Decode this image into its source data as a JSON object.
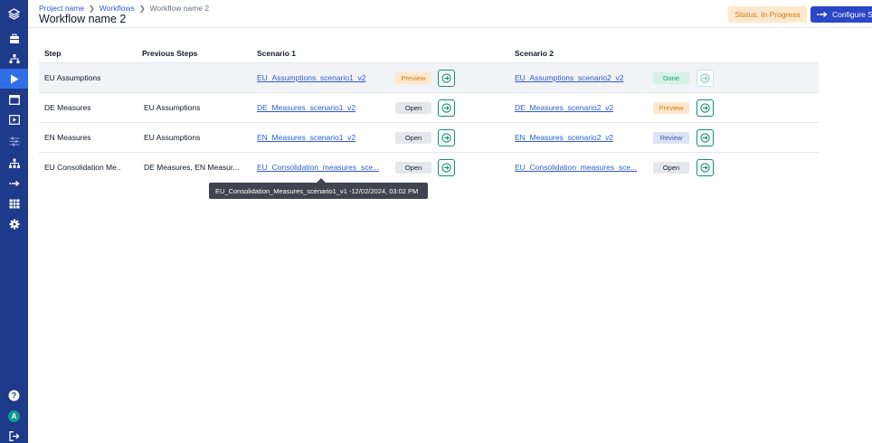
{
  "sidebar": {
    "items": [
      {
        "icon": "layers-icon"
      },
      {
        "icon": "briefcase-icon"
      },
      {
        "icon": "hierarchy-icon"
      },
      {
        "icon": "play-icon",
        "active": true
      },
      {
        "icon": "window-icon"
      },
      {
        "icon": "video-icon"
      },
      {
        "icon": "sliders-icon"
      },
      {
        "icon": "sitemap-icon"
      },
      {
        "icon": "arrow-right-icon"
      },
      {
        "icon": "grid-icon"
      },
      {
        "icon": "gear-icon"
      }
    ],
    "bottom": {
      "help_icon": "help-icon",
      "avatar_letter": "A",
      "logout_icon": "logout-icon"
    }
  },
  "header": {
    "breadcrumb": [
      "Project name",
      "Workflows",
      "Workflow name 2"
    ],
    "title": "Workflow name 2",
    "status": "Status: In Progress",
    "configure_label": "Configure Steps"
  },
  "table": {
    "headers": {
      "step": "Step",
      "previous": "Previous Steps",
      "scenario1": "Scenario 1",
      "scenario2": "Scenario 2"
    },
    "rows": [
      {
        "step": "EU Assumptions",
        "previous": "",
        "s1_link": "EU_Assumptions_scenario1_v2",
        "s1_badge": "Preview",
        "s2_link": "EU_Assumptions_scenario2_v2",
        "s2_badge": "Done"
      },
      {
        "step": "DE Measures",
        "previous": "EU Assumptions",
        "s1_link": "DE_Measures_scenario1_v2",
        "s1_badge": "Open",
        "s2_link": "DE_Measures_scenario2_v2",
        "s2_badge": "Preview"
      },
      {
        "step": "EN Measures",
        "previous": "EU Assumptions",
        "s1_link": "EN_Measures_scenario1_v2",
        "s1_badge": "Open",
        "s2_link": "EN_Measures_scenario2_v2",
        "s2_badge": "Review"
      },
      {
        "step": "EU Consolidation Me..",
        "previous": "DE Measures, EN Measur...",
        "s1_link": "EU_Consolidation_measures_sce...",
        "s1_badge": "Open",
        "s2_link": "EU_Consolidation_measures_sce...",
        "s2_badge": "Open"
      }
    ]
  },
  "tooltip": {
    "text": "EU_Consolidation_Measures_scenario1_v1 -12/02/2024, 03:02 PM"
  },
  "colors": {
    "sidebar": "#1e3a8a",
    "accent": "#2b46c7",
    "status_bg": "#fde8cf",
    "status_text": "#d97706",
    "go_border": "#0f8f6e"
  }
}
